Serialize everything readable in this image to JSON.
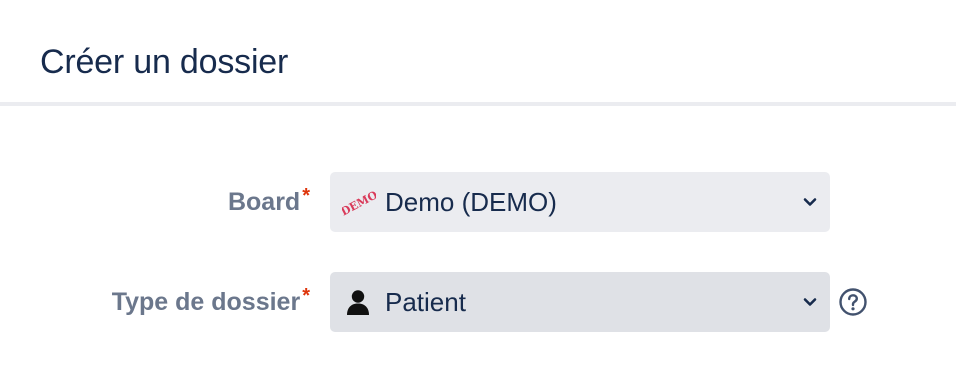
{
  "dialog": {
    "title": "Créer un dossier"
  },
  "form": {
    "board": {
      "label": "Board",
      "required_marker": "*",
      "value": "Demo (DEMO)",
      "icon": "demo-stamp-icon",
      "icon_text": "DEMO"
    },
    "type": {
      "label": "Type de dossier",
      "required_marker": "*",
      "value": "Patient",
      "icon": "user-icon"
    }
  },
  "colors": {
    "title": "#172b4d",
    "label": "#6b778c",
    "required": "#de350b",
    "select_bg": "#ebecf0",
    "select_bg_active": "#dfe1e6",
    "stamp": "#d93a5a"
  }
}
